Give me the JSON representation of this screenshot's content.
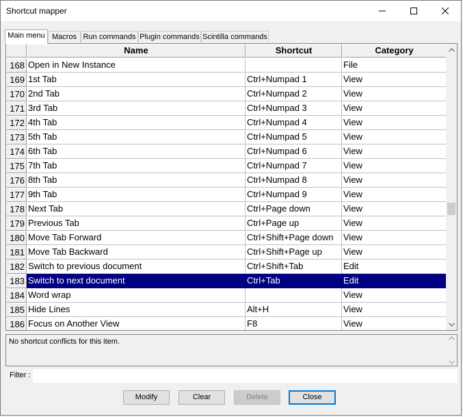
{
  "window": {
    "title": "Shortcut mapper"
  },
  "icons": {
    "minimize": "minimize-icon",
    "maximize": "maximize-icon",
    "close": "close-x-icon",
    "scroll_up": "chevron-up-icon",
    "scroll_down": "chevron-down-icon"
  },
  "tabs": [
    {
      "label": "Main menu",
      "active": true
    },
    {
      "label": "Macros",
      "active": false
    },
    {
      "label": "Run commands",
      "active": false
    },
    {
      "label": "Plugin commands",
      "active": false
    },
    {
      "label": "Scintilla commands",
      "active": false
    }
  ],
  "grid": {
    "headers": {
      "name": "Name",
      "shortcut": "Shortcut",
      "category": "Category"
    },
    "rows": [
      {
        "num": "168",
        "name": "Open in New Instance",
        "shortcut": "",
        "category": "File"
      },
      {
        "num": "169",
        "name": "1st Tab",
        "shortcut": "Ctrl+Numpad 1",
        "category": "View"
      },
      {
        "num": "170",
        "name": "2nd Tab",
        "shortcut": "Ctrl+Numpad 2",
        "category": "View"
      },
      {
        "num": "171",
        "name": "3rd Tab",
        "shortcut": "Ctrl+Numpad 3",
        "category": "View"
      },
      {
        "num": "172",
        "name": "4th Tab",
        "shortcut": "Ctrl+Numpad 4",
        "category": "View"
      },
      {
        "num": "173",
        "name": "5th Tab",
        "shortcut": "Ctrl+Numpad 5",
        "category": "View"
      },
      {
        "num": "174",
        "name": "6th Tab",
        "shortcut": "Ctrl+Numpad 6",
        "category": "View"
      },
      {
        "num": "175",
        "name": "7th Tab",
        "shortcut": "Ctrl+Numpad 7",
        "category": "View"
      },
      {
        "num": "176",
        "name": "8th Tab",
        "shortcut": "Ctrl+Numpad 8",
        "category": "View"
      },
      {
        "num": "177",
        "name": "9th Tab",
        "shortcut": "Ctrl+Numpad 9",
        "category": "View"
      },
      {
        "num": "178",
        "name": "Next Tab",
        "shortcut": "Ctrl+Page down",
        "category": "View"
      },
      {
        "num": "179",
        "name": "Previous Tab",
        "shortcut": "Ctrl+Page up",
        "category": "View"
      },
      {
        "num": "180",
        "name": "Move Tab Forward",
        "shortcut": "Ctrl+Shift+Page down",
        "category": "View"
      },
      {
        "num": "181",
        "name": "Move Tab Backward",
        "shortcut": "Ctrl+Shift+Page up",
        "category": "View"
      },
      {
        "num": "182",
        "name": "Switch to previous document",
        "shortcut": "Ctrl+Shift+Tab",
        "category": "Edit"
      },
      {
        "num": "183",
        "name": "Switch to next document",
        "shortcut": "Ctrl+Tab",
        "category": "Edit",
        "selected": true
      },
      {
        "num": "184",
        "name": "Word wrap",
        "shortcut": "",
        "category": "View"
      },
      {
        "num": "185",
        "name": "Hide Lines",
        "shortcut": "Alt+H",
        "category": "View"
      },
      {
        "num": "186",
        "name": "Focus on Another View",
        "shortcut": "F8",
        "category": "View"
      }
    ],
    "selection_color": "#000080"
  },
  "conflict": {
    "text": "No shortcut conflicts for this item."
  },
  "filter": {
    "label": "Filter :",
    "value": "",
    "placeholder": ""
  },
  "buttons": {
    "modify": "Modify",
    "clear": "Clear",
    "delete": "Delete",
    "close": "Close"
  }
}
